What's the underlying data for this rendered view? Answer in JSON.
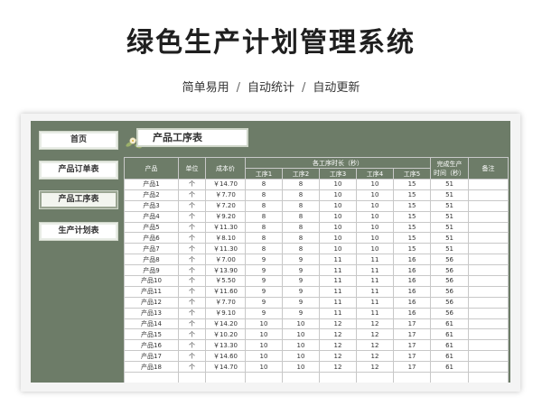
{
  "header": {
    "title": "绿色生产计划管理系统",
    "subtitle_parts": [
      "简单易用",
      "自动统计",
      "自动更新"
    ],
    "separator": "/"
  },
  "nav": {
    "items": [
      {
        "label": "首页"
      },
      {
        "label": "产品订单表"
      },
      {
        "label": "产品工序表"
      },
      {
        "label": "生产计划表"
      }
    ],
    "active": "产品工序表"
  },
  "section": {
    "title": "产品工序表"
  },
  "table": {
    "columns": {
      "product": "产品",
      "unit": "单位",
      "cost": "成本价",
      "process_group": "各工序时长（秒）",
      "processes": [
        "工序1",
        "工序2",
        "工序3",
        "工序4",
        "工序5"
      ],
      "total_line1": "完成生产",
      "total_line2": "时间（秒）",
      "note": "备注"
    },
    "rows": [
      [
        "产品1",
        "个",
        "￥14.70",
        "8",
        "8",
        "10",
        "10",
        "15",
        "51",
        ""
      ],
      [
        "产品2",
        "个",
        "￥7.70",
        "8",
        "8",
        "10",
        "10",
        "15",
        "51",
        ""
      ],
      [
        "产品3",
        "个",
        "￥7.20",
        "8",
        "8",
        "10",
        "10",
        "15",
        "51",
        ""
      ],
      [
        "产品4",
        "个",
        "￥9.20",
        "8",
        "8",
        "10",
        "10",
        "15",
        "51",
        ""
      ],
      [
        "产品5",
        "个",
        "￥11.30",
        "8",
        "8",
        "10",
        "10",
        "15",
        "51",
        ""
      ],
      [
        "产品6",
        "个",
        "￥8.10",
        "8",
        "8",
        "10",
        "10",
        "15",
        "51",
        ""
      ],
      [
        "产品7",
        "个",
        "￥11.30",
        "8",
        "8",
        "10",
        "10",
        "15",
        "51",
        ""
      ],
      [
        "产品8",
        "个",
        "￥7.00",
        "9",
        "9",
        "11",
        "11",
        "16",
        "56",
        ""
      ],
      [
        "产品9",
        "个",
        "￥13.90",
        "9",
        "9",
        "11",
        "11",
        "16",
        "56",
        ""
      ],
      [
        "产品10",
        "个",
        "￥5.50",
        "9",
        "9",
        "11",
        "11",
        "16",
        "56",
        ""
      ],
      [
        "产品11",
        "个",
        "￥11.60",
        "9",
        "9",
        "11",
        "11",
        "16",
        "56",
        ""
      ],
      [
        "产品12",
        "个",
        "￥7.70",
        "9",
        "9",
        "11",
        "11",
        "16",
        "56",
        ""
      ],
      [
        "产品13",
        "个",
        "￥9.10",
        "9",
        "9",
        "11",
        "11",
        "16",
        "56",
        ""
      ],
      [
        "产品14",
        "个",
        "￥14.20",
        "10",
        "10",
        "12",
        "12",
        "17",
        "61",
        ""
      ],
      [
        "产品15",
        "个",
        "￥10.20",
        "10",
        "10",
        "12",
        "12",
        "17",
        "61",
        ""
      ],
      [
        "产品16",
        "个",
        "￥13.30",
        "10",
        "10",
        "12",
        "12",
        "17",
        "61",
        ""
      ],
      [
        "产品17",
        "个",
        "￥14.60",
        "10",
        "10",
        "12",
        "12",
        "17",
        "61",
        ""
      ],
      [
        "产品18",
        "个",
        "￥14.70",
        "10",
        "10",
        "12",
        "12",
        "17",
        "61",
        ""
      ],
      [
        "",
        "",
        "",
        "",
        "",
        "",
        "",
        "",
        "",
        ""
      ]
    ]
  },
  "colors": {
    "panel": "#6d7c68",
    "header_cell": "#6d7c68"
  }
}
